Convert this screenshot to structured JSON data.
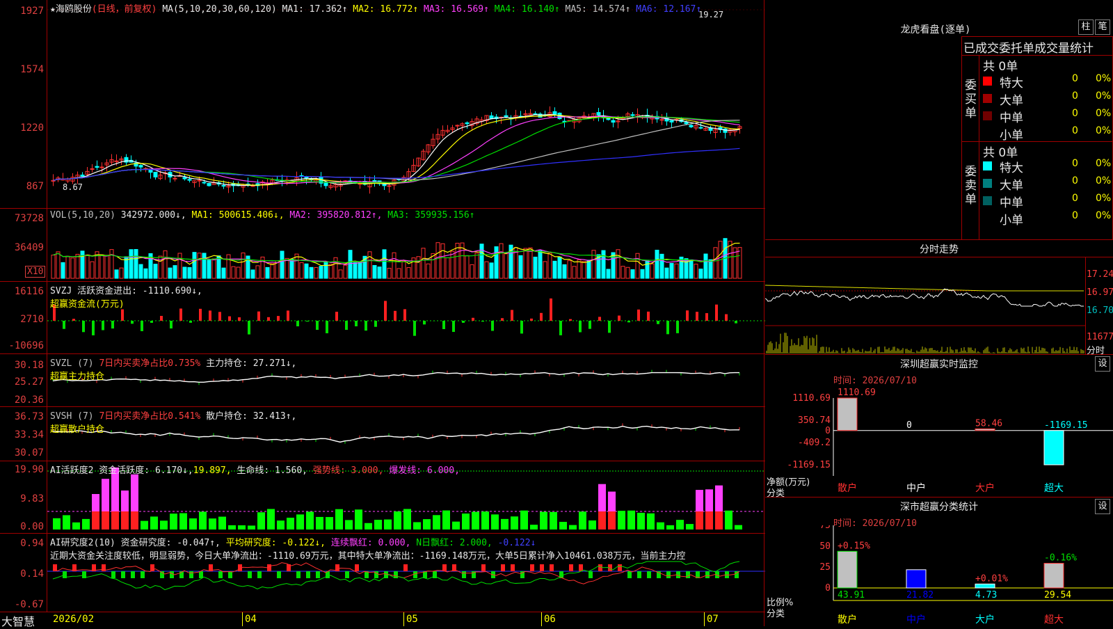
{
  "stock": {
    "name": "★海鸥股份",
    "mode": "(日线，前复权)"
  },
  "ma_bar": {
    "label": "MA(5,10,20,30,60,120)",
    "items": [
      {
        "t": "MA1: 17.362↑",
        "c": "#e8e8e8"
      },
      {
        "t": "MA2: 16.772↑",
        "c": "#ffff00"
      },
      {
        "t": "MA3: 16.569↑",
        "c": "#ff40ff"
      },
      {
        "t": "MA4: 16.140↑",
        "c": "#00e000"
      },
      {
        "t": "MA5: 14.574↑",
        "c": "#c0c0c0"
      },
      {
        "t": "MA6: 12.167↑",
        "c": "#4040ff"
      }
    ],
    "high_mark": "19.27",
    "low_mark": "8.67"
  },
  "price_axis": [
    "1927",
    "1574",
    "1220",
    "867"
  ],
  "vol": {
    "title": "VOL(5,10,20)",
    "value": "342972.000↓,",
    "ma1": "MA1: 500615.406↓,",
    "ma2": "MA2: 395820.812↑,",
    "ma3": "MA3: 359935.156↑",
    "axis": [
      "73728",
      "36409"
    ],
    "unit": "X10"
  },
  "svzj": {
    "title": "SVZJ  活跃资金进出: -1110.690↓,",
    "sub": "超赢资金流(万元)",
    "axis": [
      "16116",
      "2710",
      "-10696"
    ]
  },
  "svzl": {
    "title": "SVZL (7)",
    "ratio": "7日内买卖净占比0.735%",
    "hold": "主力持仓: 27.271↓,",
    "sub": "超赢主力持仓",
    "axis": [
      "30.18",
      "25.27",
      "20.36"
    ]
  },
  "svsh": {
    "title": "SVSH (7)",
    "ratio": "7日内买卖净占比0.541%",
    "hold": "散户持仓: 32.413↑,",
    "sub": "超赢散户持仓",
    "axis": [
      "36.73",
      "33.34",
      "30.07"
    ]
  },
  "ai1": {
    "title": "AI活跃度2 资金活跃度: 6.170↓,",
    "v2": "19.897,",
    "life": "生命线: 1.560,",
    "strong": "强势线: 3.000,",
    "burst": "爆发线: 6.000,",
    "axis": [
      "19.90",
      "9.83",
      "0.00"
    ]
  },
  "ai2": {
    "title": "AI研究度2(10) 资金研究度: -0.047↑,",
    "avg": "平均研究度: -0.122↓,",
    "red": "连续飘红: 0.000,",
    "nred": "N日飘红: 2.000,",
    "last": "-0.122↓",
    "comment": "近期大资金关注度较低，明显弱势，今日大单净流出：-1110.69万元，其中特大单净流出：-1169.148万元，大单5日累计净入10461.038万元，当前主力控",
    "axis": [
      "0.94",
      "0.14",
      "-0.67"
    ]
  },
  "time_axis": {
    "brand": "大智慧",
    "labels": [
      "2026/02",
      "04",
      "05",
      "06",
      "07"
    ]
  },
  "dragon": {
    "title": "龙虎看盘(逐单)",
    "btn1": "柱",
    "btn2": "笔",
    "tabs": "已成交委托单成交量统计",
    "buy_total": "共 0单",
    "sell_total": "共 0单",
    "buy_label": "委买单",
    "sell_label": "委卖单",
    "buy_rows": [
      {
        "name": "特大",
        "n": "0",
        "p": "0%",
        "c": "#ff0000"
      },
      {
        "name": "大单",
        "n": "0",
        "p": "0%",
        "c": "#a00000"
      },
      {
        "name": "中单",
        "n": "0",
        "p": "0%",
        "c": "#700000"
      },
      {
        "name": "小单",
        "n": "0",
        "p": "0%",
        "c": ""
      }
    ],
    "sell_rows": [
      {
        "name": "特大",
        "n": "0",
        "p": "0%",
        "c": "#00ffff"
      },
      {
        "name": "大单",
        "n": "0",
        "p": "0%",
        "c": "#008080"
      },
      {
        "name": "中单",
        "n": "0",
        "p": "0%",
        "c": "#006060"
      },
      {
        "name": "小单",
        "n": "0",
        "p": "0%",
        "c": ""
      }
    ]
  },
  "intraday": {
    "title": "分时走势",
    "axis": [
      "17.24",
      "16.97",
      "16.70"
    ],
    "vol": "11677",
    "vol_unit": "分时"
  },
  "monitor": {
    "title": "深圳超赢实时监控",
    "btn": "设",
    "time": "时间: 2026/07/10",
    "axis": [
      "1110.69",
      "350.74",
      "0",
      "-409.2",
      "-1169.15"
    ],
    "bar_labels": [
      "1110.69",
      "0",
      "58.46",
      "-1169.15"
    ],
    "y_title": "净额(万元)",
    "x_title": "分类",
    "cats": [
      "散户",
      "中户",
      "大户",
      "超大"
    ]
  },
  "classify": {
    "title": "深市超赢分类统计",
    "btn": "设",
    "time": "时间: 2026/07/10",
    "axis": [
      "75",
      "50",
      "25",
      "0"
    ],
    "top_labels": [
      "+0.15%",
      "",
      "+0.01%",
      "-0.16%"
    ],
    "values": [
      "43.91",
      "21.82",
      "4.73",
      "29.54"
    ],
    "y_title": "比例%",
    "x_title": "分类",
    "cats": [
      "散户",
      "中户",
      "大户",
      "超大"
    ]
  },
  "chart_data": [
    {
      "type": "bar",
      "title": "深圳超赢实时监控",
      "categories": [
        "散户",
        "中户",
        "大户",
        "超大"
      ],
      "values": [
        1110.69,
        0,
        58.46,
        -1169.15
      ],
      "ylabel": "净额(万元)",
      "xlabel": "分类",
      "ylim": [
        -1169.15,
        1110.69
      ]
    },
    {
      "type": "bar",
      "title": "深市超赢分类统计",
      "categories": [
        "散户",
        "中户",
        "大户",
        "超大"
      ],
      "values": [
        43.91,
        21.82,
        4.73,
        29.54
      ],
      "ylabel": "比例%",
      "xlabel": "分类",
      "ylim": [
        0,
        75
      ]
    }
  ]
}
